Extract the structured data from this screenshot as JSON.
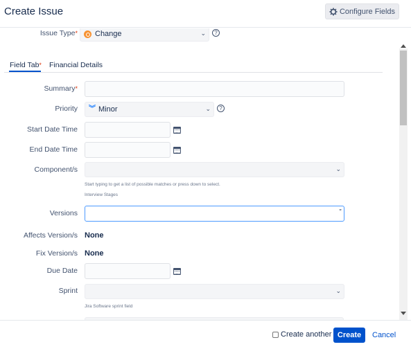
{
  "dialog": {
    "title": "Create Issue",
    "configure_label": "Configure Fields",
    "configure_icon": "gear-icon"
  },
  "issue_type": {
    "label": "Issue Type",
    "required_mark": "*",
    "value": "Change",
    "icon": "change-type-icon",
    "help": "?"
  },
  "tabs": [
    {
      "label": "Field Tab",
      "required_mark": "*",
      "active": true
    },
    {
      "label": "Financial Details",
      "active": false
    }
  ],
  "fields": {
    "summary": {
      "label": "Summary",
      "required_mark": "*",
      "value": ""
    },
    "priority": {
      "label": "Priority",
      "value": "Minor",
      "icon": "priority-minor-icon",
      "help": "?"
    },
    "start_date_time": {
      "label": "Start Date Time",
      "value": ""
    },
    "end_date_time": {
      "label": "End Date Time",
      "value": ""
    },
    "components": {
      "label": "Component/s",
      "value": "",
      "hint": "Start typing to get a list of possible matches or press down to select.",
      "sub_hint": "Interview Stages"
    },
    "versions": {
      "label": "Versions",
      "value": ""
    },
    "affects_versions": {
      "label": "Affects Version/s",
      "value": "None"
    },
    "fix_versions": {
      "label": "Fix Version/s",
      "value": "None"
    },
    "due_date": {
      "label": "Due Date",
      "value": ""
    },
    "sprint": {
      "label": "Sprint",
      "value": "",
      "hint": "Jira Software sprint field"
    }
  },
  "footer": {
    "create_another_label": "Create another",
    "create_another_checked": false,
    "create_label": "Create",
    "cancel_label": "Cancel"
  },
  "colors": {
    "primary": "#0052cc",
    "required": "#de350b",
    "focus_border": "#4c9aff"
  }
}
